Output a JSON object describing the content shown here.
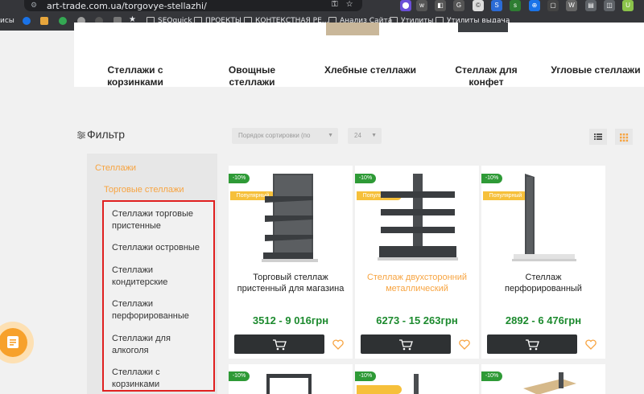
{
  "browser": {
    "url": "art-trade.com.ua/torgovye-stellazhi/",
    "bookmarks": [
      {
        "label": "исы",
        "type": "text"
      },
      {
        "label": "",
        "type": "icon"
      },
      {
        "label": "",
        "type": "icon"
      },
      {
        "label": "",
        "type": "icon"
      },
      {
        "label": "",
        "type": "icon"
      },
      {
        "label": "SEOquick",
        "type": "folder"
      },
      {
        "label": "ПРОЕКТЫ",
        "type": "folder"
      },
      {
        "label": "КОНТЕКСТНАЯ РЕ...",
        "type": "folder"
      },
      {
        "label": "Анализ Сайта",
        "type": "folder"
      },
      {
        "label": "Утилиты",
        "type": "folder"
      },
      {
        "label": "Утилиты выдача",
        "type": "folder"
      }
    ]
  },
  "categories": [
    {
      "label": "Стеллажи с корзинками"
    },
    {
      "label": "Овощные стеллажи"
    },
    {
      "label": "Хлебные стеллажи"
    },
    {
      "label": "Стеллаж для конфет"
    },
    {
      "label": "Угловые стеллажи"
    }
  ],
  "filter": {
    "title": "Фильтр",
    "level1": "Стеллажи",
    "level2": "Торговые стеллажи",
    "subcategories": [
      "Стеллажи торговые пристенные",
      "Стеллажи островные",
      "Стеллажи кондитерские",
      "Стеллажи перфорированные",
      "Стеллажи для алкоголя",
      "Стеллажи с корзинками"
    ]
  },
  "toolbar": {
    "sort_placeholder": "Порядок сортировки (по",
    "per_page": "24"
  },
  "products": [
    {
      "discount": "-10%",
      "badge": "Популярный",
      "name": "Торговый стеллаж пристенный для магазина",
      "price": "3512 - 9 016грн",
      "highlighted": false
    },
    {
      "discount": "-10%",
      "badge": "Популярный",
      "name": "Стеллаж двухсторонний металлический",
      "price": "6273 - 15 263грн",
      "highlighted": true
    },
    {
      "discount": "-10%",
      "badge": "Популярный",
      "name": "Стеллаж перфорированный",
      "price": "2892 - 6 476грн",
      "highlighted": false
    }
  ],
  "products_row2": [
    {
      "discount": "-10%"
    },
    {
      "discount": "-10%"
    },
    {
      "discount": "-10%"
    }
  ],
  "colors": {
    "accent": "#f7a441",
    "price": "#1c8a2e",
    "badge_discount": "#2e9a36",
    "badge_popular": "#f6c03b",
    "highlight_border": "#e02020",
    "cart_button": "#2e3133"
  }
}
